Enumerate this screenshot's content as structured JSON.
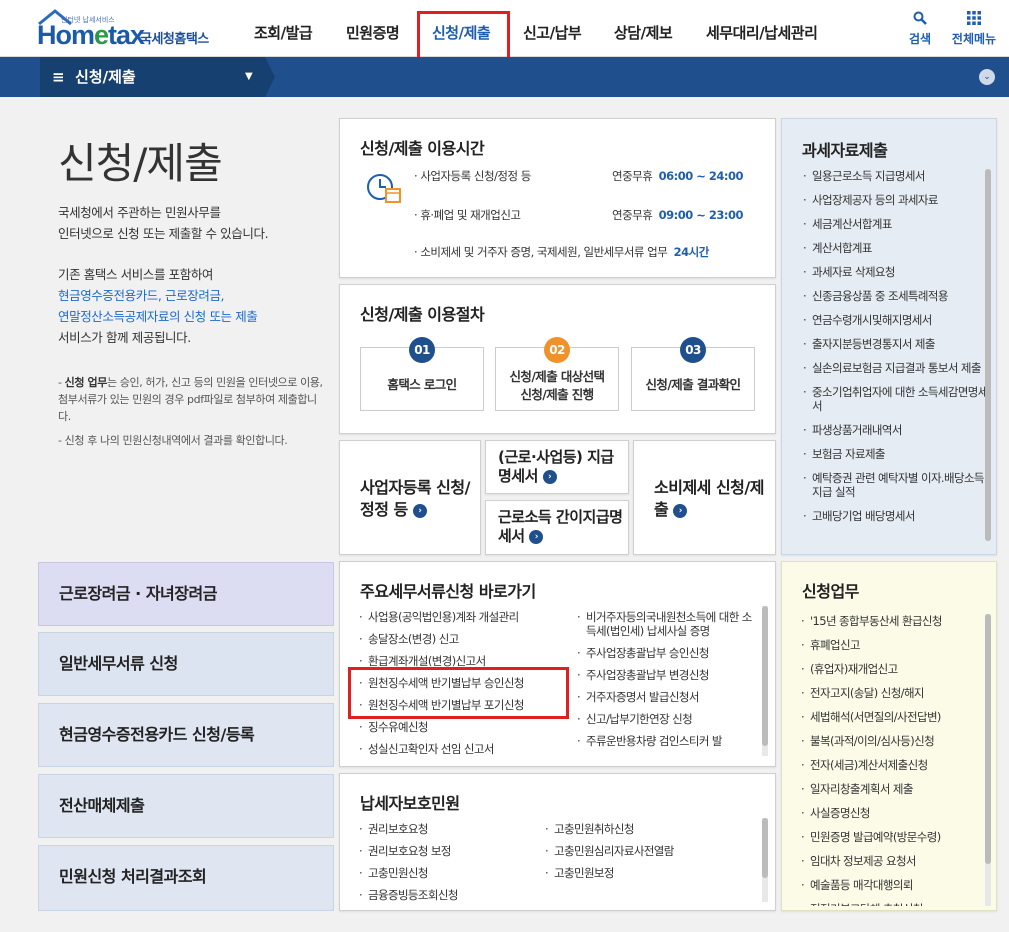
{
  "header": {
    "logo_small": "인터넷 납세서비스",
    "logo_main_a": "Hom",
    "logo_main_e": "e",
    "logo_main_b": "tax",
    "logo_korean": "국세청홈택스",
    "nav": [
      "조회/발급",
      "민원증명",
      "신청/제출",
      "신고/납부",
      "상담/제보",
      "세무대리/납세관리"
    ],
    "active_nav": "신청/제출",
    "search_label": "검색",
    "menu_label": "전체메뉴"
  },
  "subbar": {
    "title": "신청/제출"
  },
  "intro": {
    "title": "신청/제출",
    "p1": [
      "국세청에서 주관하는 민원사무를",
      "인터넷으로 신청 또는 제출할 수 있습니다."
    ],
    "p2a": "기존 홈택스 서비스를 포함하여",
    "p2_blue": [
      "현금영수증전용카드, 근로장려금,",
      "연말정산소득공제자료의 신청 또는 제출"
    ],
    "p2b": "서비스가 함께 제공됩니다.",
    "note1_bold": "신청 업무",
    "note1": "는 승인, 허가, 신고 등의 민원을 인터넷으로 이용, 첨부서류가 있는 민원의 경우 pdf파일로 첨부하여 제출합니다.",
    "note2": "신청 후 나의 민원신청내역에서 결과를 확인합니다."
  },
  "hours": {
    "title": "신청/제출 이용시간",
    "rows": [
      {
        "label": "사업자등록 신청/정정 등",
        "value_label": "연중무휴",
        "value": "06:00 ~ 24:00"
      },
      {
        "label": "휴·폐업 및 재개업신고",
        "value_label": "연중무휴",
        "value": "09:00 ~ 23:00"
      },
      {
        "label": "소비제세 및 거주자 증명, 국제세원, 일반세무서류 업무",
        "value_label": "",
        "value": "24시간"
      }
    ]
  },
  "procedure": {
    "title": "신청/제출 이용절차",
    "steps": [
      {
        "num": "01",
        "label": "홈택스 로그인",
        "color": "#1f4f8d"
      },
      {
        "num": "02",
        "label": "신청/제출 대상선택 신청/제출 진행",
        "color": "#f0922b"
      },
      {
        "num": "03",
        "label": "신청/제출 결과확인",
        "color": "#1f4f8d"
      }
    ]
  },
  "shortcuts": {
    "biz": "사업자등록 신청/정정 등",
    "earned": "(근로·사업등) 지급명세서",
    "simple": "근로소득 간이지급명세서",
    "consume": "소비제세 신청/제출"
  },
  "tax_data": {
    "title": "과세자료제출",
    "items": [
      "일용근로소득 지급명세서",
      "사업장제공자 등의 과세자료",
      "세금계산서합계표",
      "계산서합계표",
      "과세자료 삭제요청",
      "신종금융상품 중 조세특례적용",
      "연금수령개시및해지명세서",
      "출자지분등변경통지서 제출",
      "실손의료보험금 지급결과 통보서 제출",
      "중소기업취업자에 대한 소득세감면명세서",
      "파생상품거래내역서",
      "보험금 자료제출",
      "예탁증권 관련 예탁자별 이자.배당소득 지급 실적",
      "고배당기업 배당명세서"
    ]
  },
  "left_buttons": [
    "근로장려금 · 자녀장려금",
    "일반세무서류 신청",
    "현금영수증전용카드 신청/등록",
    "전산매체제출",
    "민원신청 처리결과조회"
  ],
  "major_docs": {
    "title": "주요세무서류신청 바로가기",
    "col1": [
      "사업용(공익법인용)계좌 개설관리",
      "송달장소(변경) 신고",
      "환급계좌개설(변경)신고서",
      "원천징수세액 반기별납부 승인신청",
      "원천징수세액 반기별납부 포기신청",
      "징수유예신청",
      "성실신고확인자 선임 신고서"
    ],
    "col2": [
      "비거주자등의국내원천소득에 대한 소득세(법인세) 납세사실 증명",
      "주사업장총괄납부 승인신청",
      "주사업장총괄납부 변경신청",
      "거주자증명서 발급신청서",
      "신고/납부기한연장 신청",
      "주류운반용차량 검인스티커 발"
    ]
  },
  "protection": {
    "title": "납세자보호민원",
    "col1": [
      "권리보호요청",
      "권리보호요청 보정",
      "고충민원신청",
      "금융증빙등조회신청"
    ],
    "col2": [
      "고충민원취하신청",
      "고충민원심리자료사전열람",
      "고충민원보정"
    ]
  },
  "apply_work": {
    "title": "신청업무",
    "items": [
      "'15년 종합부동산세 환급신청",
      "휴폐업신고",
      "(휴업자)재개업신고",
      "전자고지(송달) 신청/해지",
      "세법해석(서면질의/사전답변)",
      "불복(과적/이의/심사등)신청",
      "전자(세금)계산서제출신청",
      "일자리창출계획서 제출",
      "사실증명신청",
      "민원증명 발급예약(방문수령)",
      "임대차 정보제공 요청서",
      "예술품등 매각대행의뢰",
      "전적기부고단체 추천신청"
    ]
  }
}
